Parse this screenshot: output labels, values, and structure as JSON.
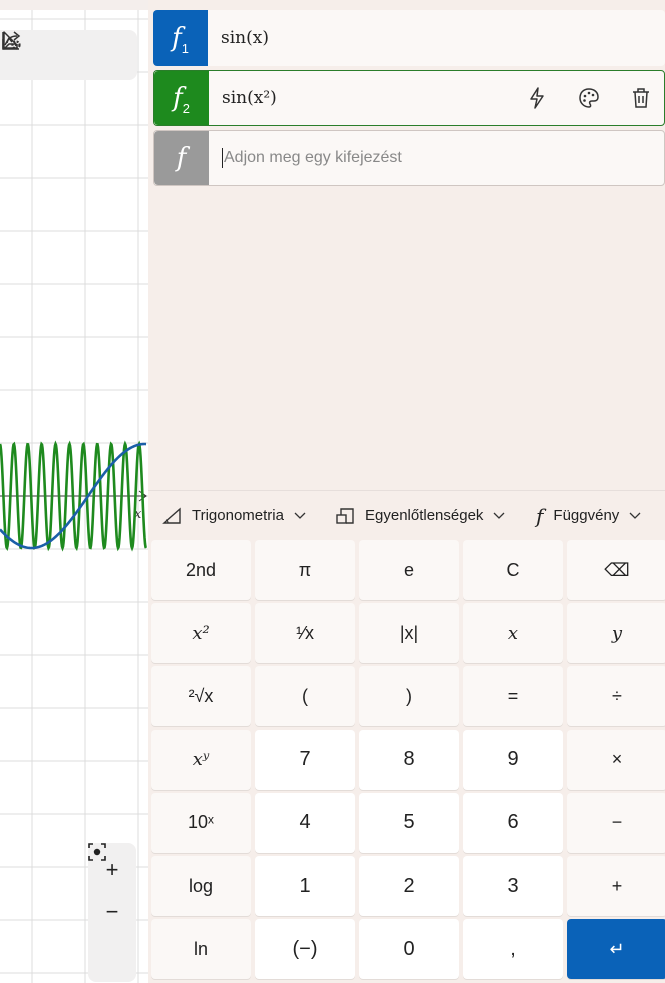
{
  "toolbar": {
    "icons": [
      "select-icon",
      "share-icon",
      "graph-settings-icon"
    ]
  },
  "graph": {
    "x_axis_label": "x",
    "series_colors": {
      "sin_x": "#1b5fa8",
      "sin_x2": "#1e8a1e"
    }
  },
  "zoom": {
    "zoom_in": "+",
    "zoom_out": "−"
  },
  "functions": [
    {
      "label": "f",
      "index": "1",
      "expression": "sin(x)",
      "color": "#0a62b8"
    },
    {
      "label": "f",
      "index": "2",
      "expression": "sin(x²)",
      "color": "#1e8a1e"
    }
  ],
  "new_function": {
    "label": "f",
    "placeholder": "Adjon meg egy kifejezést",
    "color": "#9a9a9a"
  },
  "categories": [
    {
      "label": "Trigonometria",
      "icon": "triangle-icon"
    },
    {
      "label": "Egyenlőtlenségek",
      "icon": "inequality-icon"
    },
    {
      "label": "Függvény",
      "icon": "function-icon"
    }
  ],
  "keys": {
    "row1": [
      "2nd",
      "π",
      "e",
      "C",
      "⌫"
    ],
    "row2": [
      "x²",
      "¹⁄x",
      "|x|",
      "x",
      "y"
    ],
    "row3": [
      "²√x",
      "(",
      ")",
      "=",
      "÷"
    ],
    "row4": [
      "xʸ",
      "7",
      "8",
      "9",
      "×"
    ],
    "row5": [
      "10ˣ",
      "4",
      "5",
      "6",
      "−"
    ],
    "row6": [
      "log",
      "1",
      "2",
      "3",
      "+"
    ],
    "row7": [
      "ln",
      "(−)",
      "0",
      ",",
      "↵"
    ]
  },
  "accent_color": "#0a62b8"
}
